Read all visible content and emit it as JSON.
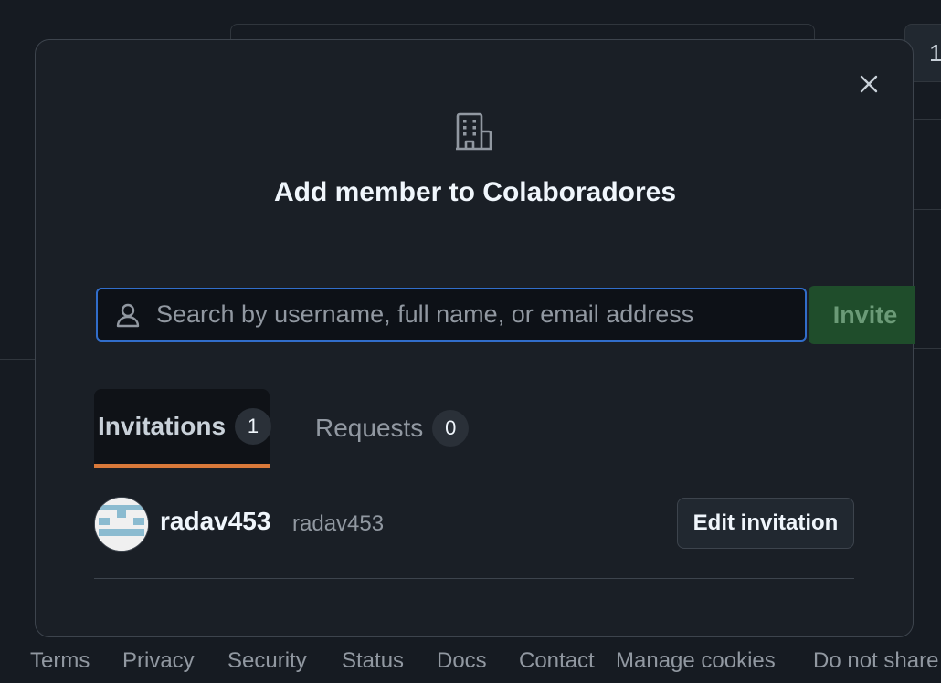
{
  "dialog": {
    "title": "Add member to Colaboradores",
    "close_icon": "close-icon",
    "header_icon": "organization-icon"
  },
  "search": {
    "placeholder": "Search by username, full name, or email address",
    "value": "",
    "icon": "person-icon"
  },
  "invite_button": {
    "label": "Invite"
  },
  "tabs": [
    {
      "label": "Invitations",
      "count": "1",
      "selected": true
    },
    {
      "label": "Requests",
      "count": "0",
      "selected": false
    }
  ],
  "members": [
    {
      "name": "radav453",
      "login": "radav453",
      "action_label": "Edit invitation"
    }
  ],
  "background": {
    "card_count": "1"
  },
  "footer": {
    "links": [
      "Terms",
      "Privacy",
      "Security",
      "Status",
      "Docs",
      "Contact",
      "Manage cookies",
      "Do not share"
    ]
  },
  "colors": {
    "accent_border": "#316dca",
    "invite_button_bg": "#1f4d2b",
    "tab_underline": "#d9793a"
  }
}
